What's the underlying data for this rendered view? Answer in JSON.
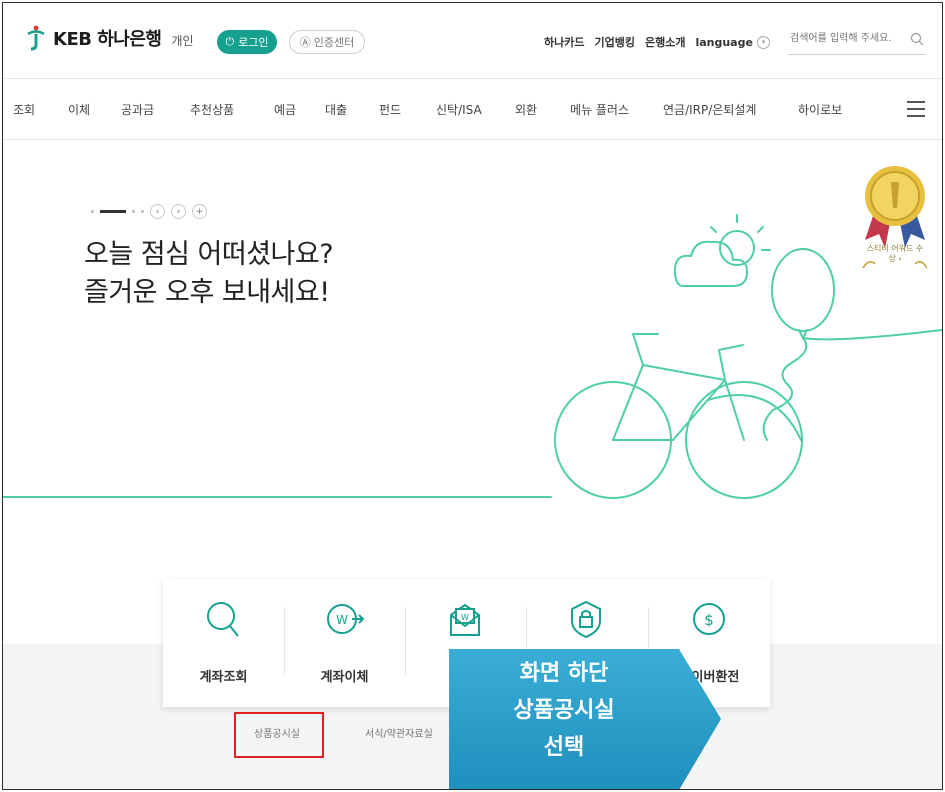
{
  "header": {
    "logo_text": "KEB 하나은행",
    "logo_sub": "개인",
    "login_label": "로그인",
    "cert_label": "인증센터",
    "links": [
      "하나카드",
      "기업뱅킹",
      "은행소개"
    ],
    "language_label": "language",
    "search_placeholder": "검색어를 입력해 주세요."
  },
  "nav": {
    "items": [
      "조회",
      "이체",
      "공과금",
      "추천상품",
      "예금",
      "대출",
      "펀드",
      "신탁/ISA",
      "외환",
      "메뉴 플러스",
      "연금/IRP/은퇴설계",
      "하이로보"
    ]
  },
  "hero": {
    "line1": "오늘 점심 어떠셨나요?",
    "line2": "즐거운 오후 보내세요!",
    "award_text": "스티비 어워드 수상 ›"
  },
  "quick_menu": {
    "items": [
      "계좌조회",
      "계좌이체",
      "",
      "",
      "사이버환전"
    ]
  },
  "bottom_links": [
    "상품공시실",
    "서식/약관자료실"
  ],
  "callout": {
    "line1": "화면 하단",
    "line2": "상품공시실",
    "line3": "선택"
  },
  "colors": {
    "brand": "#16a08f",
    "illustration": "#4fcfa0",
    "callout": "#2a9fcb",
    "highlight": "#e02020"
  }
}
